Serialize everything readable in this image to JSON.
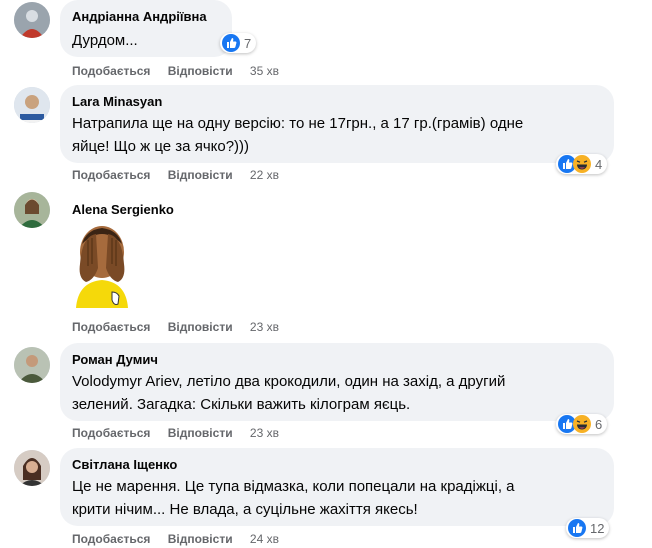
{
  "actions": {
    "like_label": "Подобається",
    "reply_label": "Відповісти"
  },
  "colors": {
    "like_blue": "#1877f2",
    "haha_yellow": "#f7b125",
    "bubble_bg": "#f0f2f5"
  },
  "comments": [
    {
      "author": "Андріанна Андріївна",
      "lines": [
        "Дурдом..."
      ],
      "time": "35 хв",
      "reactions": [
        "like-icon"
      ],
      "count": "7"
    },
    {
      "author": "Lara Minasyan",
      "lines": [
        "Натрапила ще на одну версію: то не 17грн., а 17 гр.(грамів) одне",
        "яйце! Що ж це за ячко?)))"
      ],
      "time": "22 хв",
      "reactions": [
        "like-icon",
        "haha-icon"
      ],
      "count": "4"
    },
    {
      "author": "Alena Sergienko",
      "sticker": "covering-face-sticker",
      "time": "23 хв"
    },
    {
      "author": "Роман Думич",
      "lines": [
        "Volodymyr Ariev, летіло два крокодили, один на захід, а другий",
        "зелений. Загадка: Скільки важить кілограм яєць."
      ],
      "time": "23 хв",
      "reactions": [
        "like-icon",
        "haha-icon"
      ],
      "count": "6"
    },
    {
      "author": "Світлана Іщенко",
      "lines": [
        "Це не марення. Це тупа відмазка, коли попецали на крадіжці, а",
        "крити нічим... Не влада, а суцільне жахіття якесь!"
      ],
      "time": "24 хв",
      "reactions": [
        "like-icon"
      ],
      "count": "12"
    }
  ]
}
